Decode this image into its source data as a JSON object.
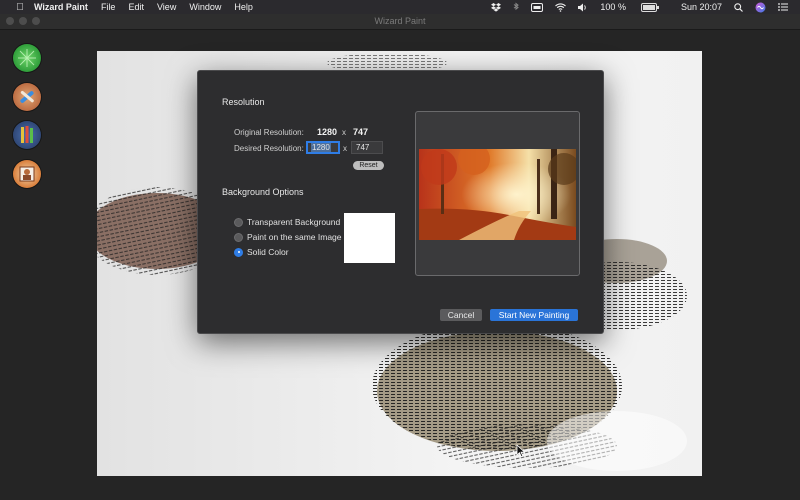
{
  "menubar": {
    "app_name": "Wizard Paint",
    "menus": [
      "File",
      "Edit",
      "View",
      "Window",
      "Help"
    ],
    "battery_text": "100 %",
    "battery_level": 1.0,
    "clock": "Sun 20:07",
    "status_icons": [
      "dropbox-icon",
      "bluetooth-icon",
      "display-icon",
      "wifi-icon",
      "volume-icon",
      "battery-icon"
    ],
    "right_icons": [
      "spotlight-icon",
      "siri-icon",
      "notification-center-icon"
    ]
  },
  "window": {
    "title": "Wizard Paint"
  },
  "toolbar": {
    "tools": [
      "pattern-tool-icon",
      "brush-tool-icon",
      "pencils-tool-icon",
      "portrait-tool-icon"
    ]
  },
  "dialog": {
    "resolution_title": "Resolution",
    "original_label": "Original Resolution:",
    "original_width": "1280",
    "original_height": "747",
    "times": "x",
    "desired_label": "Desired Resolution:",
    "desired_width": "1280",
    "desired_height": "747",
    "reset_label": "Reset",
    "background_title": "Background Options",
    "options": [
      {
        "label": "Transparent Background",
        "selected": false
      },
      {
        "label": "Paint on the same Image",
        "selected": false
      },
      {
        "label": "Solid Color",
        "selected": true
      }
    ],
    "solid_color": "#ffffff",
    "cancel_label": "Cancel",
    "start_label": "Start New Painting"
  },
  "colors": {
    "accent": "#2f7de6",
    "dialog_bg": "#2d2d2f",
    "menubar_bg": "#2b2a2e"
  }
}
